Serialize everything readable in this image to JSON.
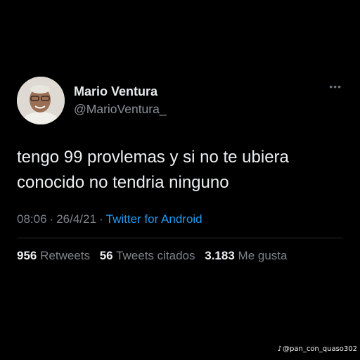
{
  "tweet": {
    "display_name": "Mario Ventura",
    "handle": "@MarioVentura_",
    "text": "tengo 99 provlemas y si no te ubiera\nconocido no tendria ninguno",
    "time": "08:06",
    "date": "26/4/21",
    "source": "Twitter for Android",
    "more_icon": "more-horizontal-icon",
    "stats": {
      "retweets_count": "956",
      "retweets_label": "Retweets",
      "quotes_count": "56",
      "quotes_label": "Tweets citados",
      "likes_count": "3.183",
      "likes_label": "Me gusta"
    }
  },
  "watermark": {
    "icon": "tiktok-icon",
    "text": "@pan_con_quaso302"
  },
  "colors": {
    "background": "#000000",
    "link": "#1d9bf0",
    "muted": "#7d838a"
  }
}
